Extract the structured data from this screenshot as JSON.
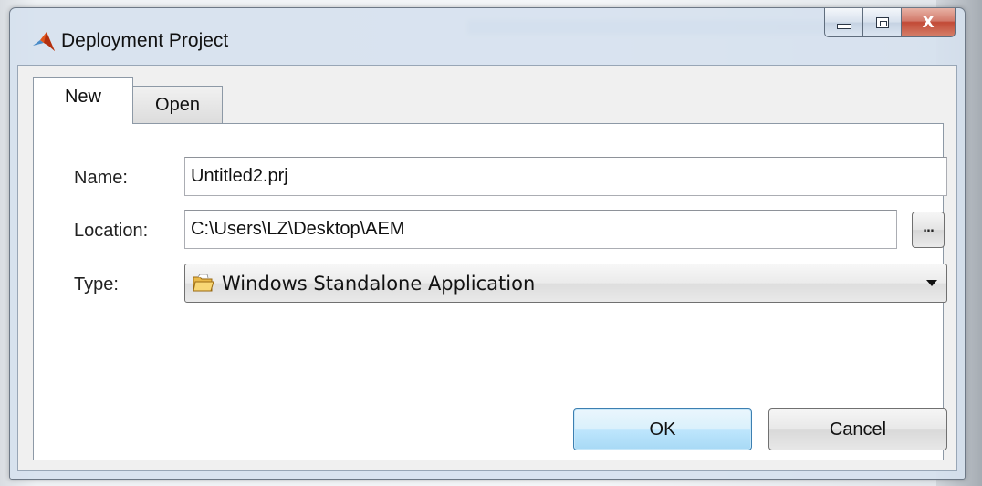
{
  "window": {
    "title": "Deployment Project",
    "app_icon": "matlab-logo-icon",
    "controls": {
      "minimize": "minimize-icon",
      "maximize": "maximize-icon",
      "close": "X"
    }
  },
  "tabs": [
    {
      "label": "New",
      "selected": true
    },
    {
      "label": "Open",
      "selected": false
    }
  ],
  "form": {
    "name_label": "Name:",
    "name_value": "Untitled2.prj",
    "location_label": "Location:",
    "location_value": "C:\\Users\\LZ\\Desktop\\AEM",
    "browse_label": "...",
    "type_label": "Type:",
    "type_value": "Windows Standalone Application",
    "type_icon": "folder-icon"
  },
  "buttons": {
    "ok": "OK",
    "cancel": "Cancel"
  },
  "colors": {
    "ok_button": "#bee6fd",
    "close_button": "#c24a36",
    "title_bar": "#d6e1ee"
  }
}
